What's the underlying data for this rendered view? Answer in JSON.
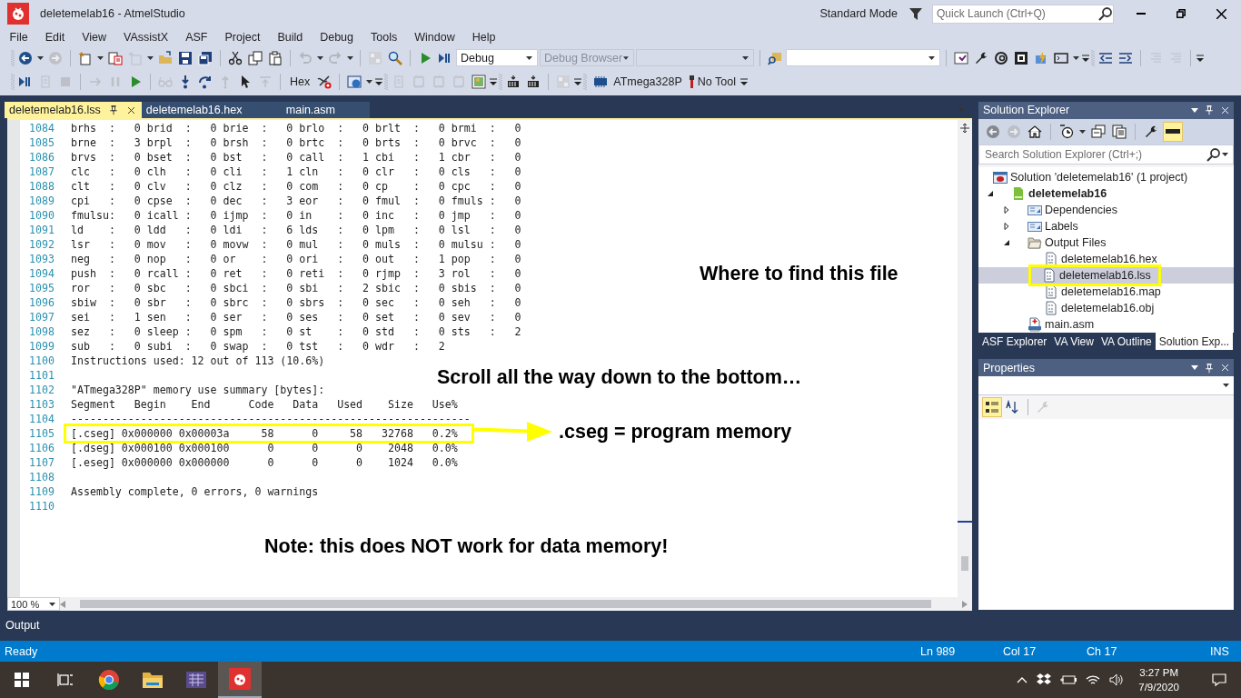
{
  "window": {
    "title": "deletemelab16 - AtmelStudio",
    "mode": "Standard Mode",
    "quick_launch": {
      "placeholder": "Quick Launch (Ctrl+Q)"
    }
  },
  "menu": [
    "File",
    "Edit",
    "View",
    "VAssistX",
    "ASF",
    "Project",
    "Build",
    "Debug",
    "Tools",
    "Window",
    "Help"
  ],
  "toolbar": {
    "configuration": {
      "value": "Debug",
      "disabled": false
    },
    "debug_browser": {
      "value": "Debug Browser",
      "disabled": true
    },
    "hex_button": "Hex",
    "device": "ATmega328P",
    "tool": "No Tool"
  },
  "tabs": [
    {
      "label": "deletemelab16.lss",
      "selected": true
    },
    {
      "label": "deletemelab16.hex",
      "selected": false
    },
    {
      "label": "main.asm",
      "selected": false
    }
  ],
  "editor": {
    "lines": [
      {
        "number": "1084",
        "text": "brhs  :   0 brid  :   0 brie  :   0 brlo  :   0 brlt  :   0 brmi  :   0"
      },
      {
        "number": "1085",
        "text": "brne  :   3 brpl  :   0 brsh  :   0 brtc  :   0 brts  :   0 brvc  :   0"
      },
      {
        "number": "1086",
        "text": "brvs  :   0 bset  :   0 bst   :   0 call  :   1 cbi   :   1 cbr   :   0"
      },
      {
        "number": "1087",
        "text": "clc   :   0 clh   :   0 cli   :   1 cln   :   0 clr   :   0 cls   :   0"
      },
      {
        "number": "1088",
        "text": "clt   :   0 clv   :   0 clz   :   0 com   :   0 cp    :   0 cpc   :   0"
      },
      {
        "number": "1089",
        "text": "cpi   :   0 cpse  :   0 dec   :   3 eor   :   0 fmul  :   0 fmuls :   0"
      },
      {
        "number": "1090",
        "text": "fmulsu:   0 icall :   0 ijmp  :   0 in    :   0 inc   :   0 jmp   :   0"
      },
      {
        "number": "1091",
        "text": "ld    :   0 ldd   :   0 ldi   :   6 lds   :   0 lpm   :   0 lsl   :   0"
      },
      {
        "number": "1092",
        "text": "lsr   :   0 mov   :   0 movw  :   0 mul   :   0 muls  :   0 mulsu :   0"
      },
      {
        "number": "1093",
        "text": "neg   :   0 nop   :   0 or    :   0 ori   :   0 out   :   1 pop   :   0"
      },
      {
        "number": "1094",
        "text": "push  :   0 rcall :   0 ret   :   0 reti  :   0 rjmp  :   3 rol   :   0"
      },
      {
        "number": "1095",
        "text": "ror   :   0 sbc   :   0 sbci  :   0 sbi   :   2 sbic  :   0 sbis  :   0"
      },
      {
        "number": "1096",
        "text": "sbiw  :   0 sbr   :   0 sbrc  :   0 sbrs  :   0 sec   :   0 seh   :   0"
      },
      {
        "number": "1097",
        "text": "sei   :   1 sen   :   0 ser   :   0 ses   :   0 set   :   0 sev   :   0"
      },
      {
        "number": "1098",
        "text": "sez   :   0 sleep :   0 spm   :   0 st    :   0 std   :   0 sts   :   2"
      },
      {
        "number": "1099",
        "text": "sub   :   0 subi  :   0 swap  :   0 tst   :   0 wdr   :   2"
      },
      {
        "number": "1100",
        "text": "Instructions used: 12 out of 113 (10.6%)"
      },
      {
        "number": "1101"
      },
      {
        "number": "1102",
        "text": "\"ATmega328P\" memory use summary [bytes]:"
      },
      {
        "number": "1103",
        "text": "Segment   Begin    End      Code   Data   Used    Size   Use%"
      },
      {
        "number": "1104",
        "text": "---------------------------------------------------------------"
      },
      {
        "number": "1105",
        "text": "[.cseg] 0x000000 0x00003a     58      0     58   32768   0.2%",
        "highlighted": true
      },
      {
        "number": "1106",
        "text": "[.dseg] 0x000100 0x000100      0      0      0    2048   0.0%"
      },
      {
        "number": "1107",
        "text": "[.eseg] 0x000000 0x000000      0      0      0    1024   0.0%"
      },
      {
        "number": "1108"
      },
      {
        "number": "1109",
        "text": "Assembly complete, 0 errors, 0 warnings"
      },
      {
        "number": "1110"
      }
    ],
    "zoom": "100 %"
  },
  "annotations": [
    "Where to find this file",
    "Scroll all the way down to the bottom…",
    ".cseg = program memory",
    "Note: this does NOT work for data memory!"
  ],
  "solution_explorer": {
    "title": "Solution Explorer",
    "preview_on": true,
    "search": {
      "placeholder": "Search Solution Explorer (Ctrl+;)"
    },
    "tree": [
      {
        "label": "Solution 'deletemelab16' (1 project)",
        "kind": "solution",
        "selected": false,
        "children": [
          {
            "label": "deletemelab16",
            "kind": "project",
            "selected": false,
            "expanded": true,
            "children": [
              {
                "label": "Dependencies",
                "kind": "reference",
                "selected": false,
                "expanded": false
              },
              {
                "label": "Labels",
                "kind": "reference",
                "selected": false,
                "expanded": false
              },
              {
                "label": "Output Files",
                "kind": "folder",
                "selected": false,
                "expanded": true,
                "children": [
                  {
                    "label": "deletemelab16.hex",
                    "kind": "file",
                    "selected": false
                  },
                  {
                    "label": "deletemelab16.lss",
                    "kind": "file",
                    "selected": true
                  },
                  {
                    "label": "deletemelab16.map",
                    "kind": "file",
                    "selected": false
                  },
                  {
                    "label": "deletemelab16.obj",
                    "kind": "file",
                    "selected": false
                  }
                ]
              },
              {
                "label": "main.asm",
                "kind": "asm",
                "selected": false
              }
            ]
          }
        ]
      }
    ],
    "tabs": [
      {
        "label": "ASF Explorer",
        "selected": false
      },
      {
        "label": "VA View",
        "selected": false
      },
      {
        "label": "VA Outline",
        "selected": false
      },
      {
        "label": "Solution Exp...",
        "selected": true
      }
    ]
  },
  "properties": {
    "title": "Properties"
  },
  "output_tab": "Output",
  "status_bar": {
    "message": "Ready",
    "line": "Ln 989",
    "column": "Col 17",
    "char": "Ch 17",
    "mode": "INS"
  },
  "taskbar": {
    "time": "3:27 PM",
    "date": "7/9/2020"
  }
}
